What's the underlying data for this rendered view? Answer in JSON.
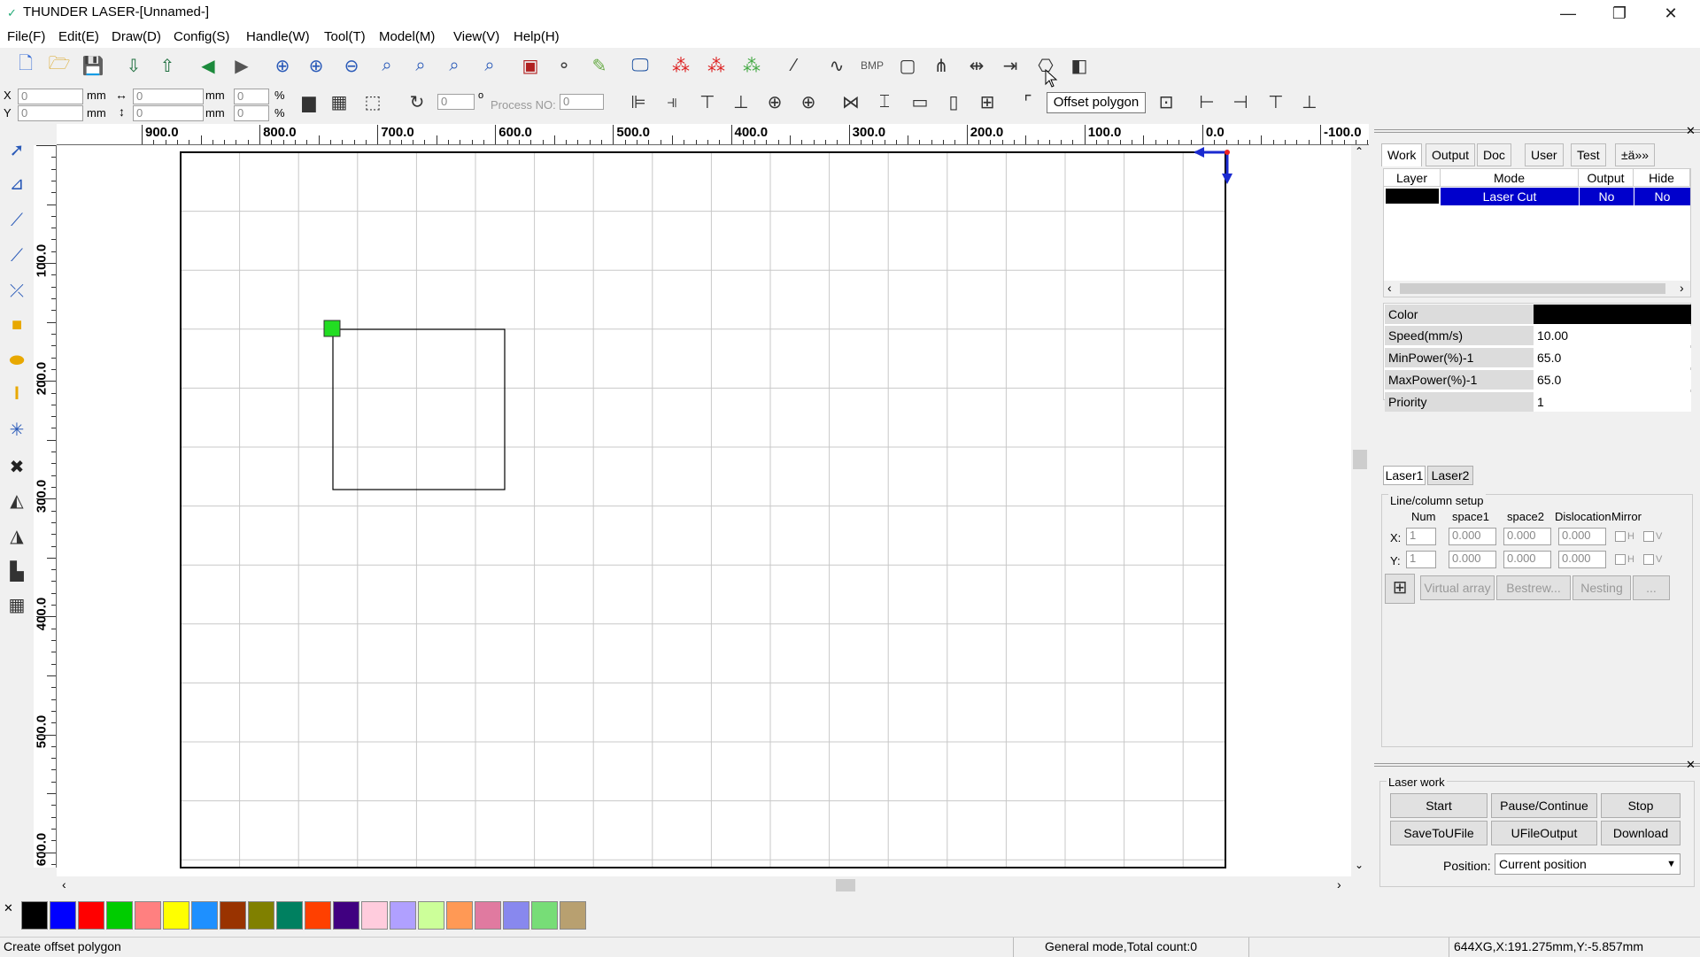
{
  "window": {
    "title": "THUNDER LASER-[Unnamed-]"
  },
  "menu": [
    "File(F)",
    "Edit(E)",
    "Config(S)",
    "Draw(D)",
    "Handle(W)",
    "Tool(T)",
    "Model(M)",
    "View(V)",
    "Help(H)"
  ],
  "coords": {
    "x_label": "X",
    "y_label": "Y",
    "x_value": "0",
    "y_value": "0",
    "w_value": "0",
    "h_value": "0",
    "unit_mm": "mm",
    "xpct": "0",
    "ypct": "0",
    "pct": "%",
    "rotate_value": "0",
    "degree": "o",
    "process_label": "Process NO:",
    "process_value": "0"
  },
  "tooltip": "Offset polygon",
  "ruler": {
    "h_labels": [
      "900.0",
      "800.0",
      "700.0",
      "600.0",
      "500.0",
      "400.0",
      "300.0",
      "200.0",
      "100.0",
      "0.0",
      "-100.0"
    ],
    "v_labels": [
      "100.0",
      "200.0",
      "300.0",
      "400.0",
      "500.0",
      "600.0"
    ]
  },
  "right_panel": {
    "tabs": [
      "Work",
      "Output",
      "Doc",
      "User",
      "Test",
      "±ä»»"
    ],
    "layer_headers": [
      "Layer",
      "Mode",
      "Output",
      "Hide"
    ],
    "layer_row": {
      "mode": "Laser Cut",
      "output": "No",
      "hide": "No",
      "color": "#000000"
    },
    "props": [
      {
        "label": "Color",
        "value": ""
      },
      {
        "label": "Speed(mm/s)",
        "value": "10.00"
      },
      {
        "label": "MinPower(%)-1",
        "value": "65.0"
      },
      {
        "label": "MaxPower(%)-1",
        "value": "65.0"
      },
      {
        "label": "Priority",
        "value": "1"
      }
    ],
    "laser_tabs": [
      "Laser1",
      "Laser2"
    ],
    "linecol": {
      "title": "Line/column setup",
      "headers": [
        "Num",
        "space1",
        "space2",
        "Dislocation",
        "Mirror"
      ],
      "x_label": "X:",
      "y_label": "Y:",
      "x_values": [
        "1",
        "0.000",
        "0.000",
        "0.000"
      ],
      "y_values": [
        "1",
        "0.000",
        "0.000",
        "0.000"
      ],
      "h": "H",
      "v": "V",
      "buttons": [
        "Virtual array",
        "Bestrew...",
        "Nesting",
        "..."
      ]
    },
    "laser_work": {
      "title": "Laser work",
      "start": "Start",
      "pause": "Pause/Continue",
      "stop": "Stop",
      "save": "SaveToUFile",
      "ufile": "UFileOutput",
      "download": "Download",
      "position_label": "Position:",
      "position_value": "Current position"
    }
  },
  "palette": [
    "#000000",
    "#0000ff",
    "#ff0000",
    "#00cc00",
    "#ff8080",
    "#ffff00",
    "#1e90ff",
    "#993300",
    "#808000",
    "#008060",
    "#ff4000",
    "#400080",
    "#ffccdd",
    "#b0a0ff",
    "#ccff99",
    "#ff9955",
    "#e07aa0",
    "#8888ee",
    "#77dd77",
    "#b8a070"
  ],
  "status": {
    "left": "Create offset polygon",
    "mid": "General mode,Total count:0",
    "right": "644XG,X:191.275mm,Y:-5.857mm"
  }
}
